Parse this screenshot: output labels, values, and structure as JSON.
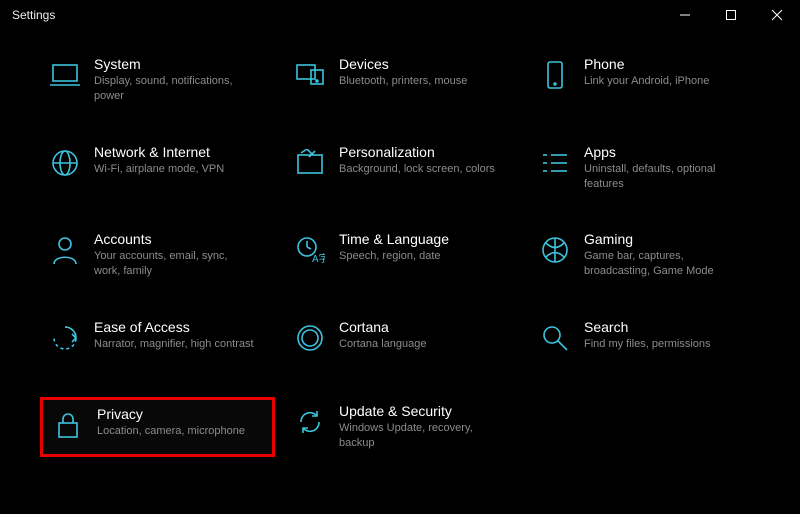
{
  "window": {
    "title": "Settings"
  },
  "tiles": [
    {
      "title": "System",
      "desc": "Display, sound, notifications, power"
    },
    {
      "title": "Devices",
      "desc": "Bluetooth, printers, mouse"
    },
    {
      "title": "Phone",
      "desc": "Link your Android, iPhone"
    },
    {
      "title": "Network & Internet",
      "desc": "Wi-Fi, airplane mode, VPN"
    },
    {
      "title": "Personalization",
      "desc": "Background, lock screen, colors"
    },
    {
      "title": "Apps",
      "desc": "Uninstall, defaults, optional features"
    },
    {
      "title": "Accounts",
      "desc": "Your accounts, email, sync, work, family"
    },
    {
      "title": "Time & Language",
      "desc": "Speech, region, date"
    },
    {
      "title": "Gaming",
      "desc": "Game bar, captures, broadcasting, Game Mode"
    },
    {
      "title": "Ease of Access",
      "desc": "Narrator, magnifier, high contrast"
    },
    {
      "title": "Cortana",
      "desc": "Cortana language"
    },
    {
      "title": "Search",
      "desc": "Find my files, permissions"
    },
    {
      "title": "Privacy",
      "desc": "Location, camera, microphone"
    },
    {
      "title": "Update & Security",
      "desc": "Windows Update, recovery, backup"
    }
  ]
}
